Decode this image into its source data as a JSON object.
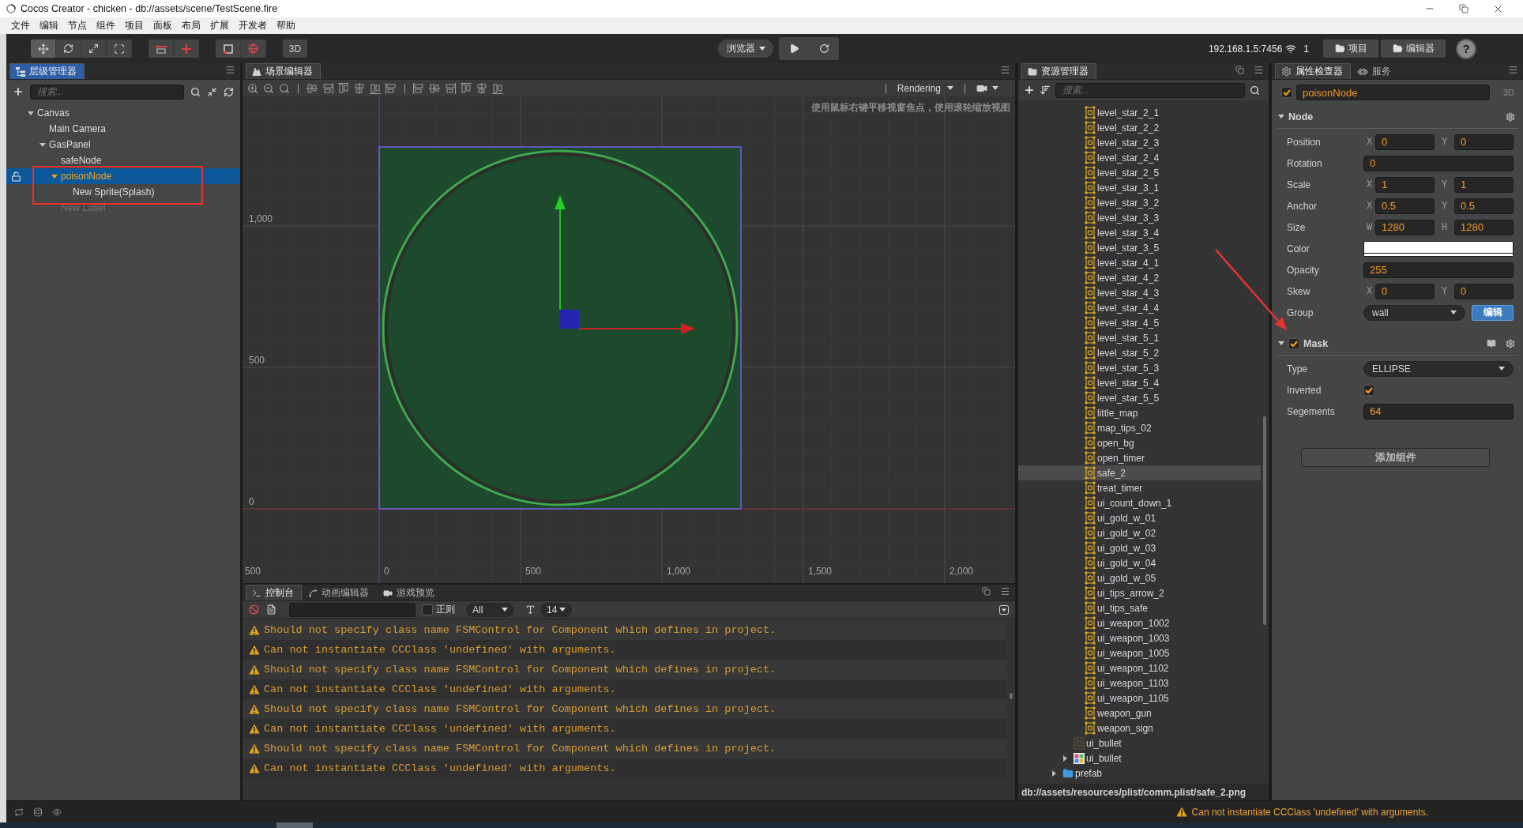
{
  "window": {
    "title": "Cocos Creator - chicken - db://assets/scene/TestScene.fire"
  },
  "menu": [
    "文件",
    "编辑",
    "节点",
    "组件",
    "项目",
    "面板",
    "布局",
    "扩展",
    "开发者",
    "帮助"
  ],
  "toolbar": {
    "transform_tools": [
      {
        "kind": "move",
        "selected": true
      },
      {
        "kind": "rotate",
        "selected": false
      },
      {
        "kind": "scale",
        "selected": false
      },
      {
        "kind": "rect",
        "selected": false
      }
    ],
    "view_3d": "3D",
    "preview_target": "浏览器",
    "server": "192.168.1.5:7456",
    "client_count": "1",
    "buttons": [
      "项目",
      "编辑器"
    ],
    "help": "?"
  },
  "hierarchy": {
    "tab": "层级管理器",
    "focused": true,
    "search_placeholder": "搜索...",
    "tree": [
      {
        "name": "Canvas",
        "expanded": true,
        "selected": false,
        "active": true,
        "children": [
          {
            "name": "Main Camera",
            "selected": false,
            "active": true
          },
          {
            "name": "GasPanel",
            "expanded": true,
            "selected": false,
            "active": true,
            "children": [
              {
                "name": "safeNode",
                "selected": false,
                "active": true
              },
              {
                "name": "poisonNode",
                "expanded": true,
                "selected": true,
                "active": true,
                "children": [
                  {
                    "name": "New Sprite(Splash)",
                    "selected": false,
                    "active": true
                  }
                ]
              },
              {
                "name": "New Label",
                "selected": false,
                "active": false
              }
            ]
          }
        ]
      }
    ]
  },
  "scene": {
    "tab": "场景编辑器",
    "focused": false,
    "render_mode": "Rendering",
    "hint": "使用鼠标右键平移视窗焦点，使用滚轮缩放视图",
    "y_labels": [
      "1,000",
      "500",
      "0"
    ],
    "x_labels": [
      "500",
      "0",
      "500",
      "1,000",
      "1,500",
      "2,000"
    ]
  },
  "console": {
    "tabs": [
      {
        "label": "控制台",
        "selected": true
      },
      {
        "label": "动画编辑器",
        "selected": false
      },
      {
        "label": "游戏预览",
        "selected": false
      }
    ],
    "regex": {
      "label": "正则",
      "checked": false
    },
    "level": "All",
    "font_size": "14",
    "logs": [
      {
        "kind": "warning",
        "text": "Should not specify class name FSMControl for Component which defines in project."
      },
      {
        "kind": "warning",
        "text": "Can not instantiate CCClass 'undefined' with arguments."
      },
      {
        "kind": "warning",
        "text": "Should not specify class name FSMControl for Component which defines in project."
      },
      {
        "kind": "warning",
        "text": "Can not instantiate CCClass 'undefined' with arguments."
      },
      {
        "kind": "warning",
        "text": "Should not specify class name FSMControl for Component which defines in project."
      },
      {
        "kind": "warning",
        "text": "Can not instantiate CCClass 'undefined' with arguments."
      },
      {
        "kind": "warning",
        "text": "Should not specify class name FSMControl for Component which defines in project."
      },
      {
        "kind": "warning",
        "text": "Can not instantiate CCClass 'undefined' with arguments."
      }
    ]
  },
  "assets": {
    "tab": "资源管理器",
    "focused": false,
    "search_placeholder": "搜索...",
    "tree": [
      {
        "children": [
          {
            "children": [
              {
                "name": "level_star_2_1",
                "kind": "sprite-frame",
                "selected": false
              },
              {
                "name": "level_star_2_2",
                "kind": "sprite-frame",
                "selected": false
              },
              {
                "name": "level_star_2_3",
                "kind": "sprite-frame",
                "selected": false
              },
              {
                "name": "level_star_2_4",
                "kind": "sprite-frame",
                "selected": false
              },
              {
                "name": "level_star_2_5",
                "kind": "sprite-frame",
                "selected": false
              },
              {
                "name": "level_star_3_1",
                "kind": "sprite-frame",
                "selected": false
              },
              {
                "name": "level_star_3_2",
                "kind": "sprite-frame",
                "selected": false
              },
              {
                "name": "level_star_3_3",
                "kind": "sprite-frame",
                "selected": false
              },
              {
                "name": "level_star_3_4",
                "kind": "sprite-frame",
                "selected": false
              },
              {
                "name": "level_star_3_5",
                "kind": "sprite-frame",
                "selected": false
              },
              {
                "name": "level_star_4_1",
                "kind": "sprite-frame",
                "selected": false
              },
              {
                "name": "level_star_4_2",
                "kind": "sprite-frame",
                "selected": false
              },
              {
                "name": "level_star_4_3",
                "kind": "sprite-frame",
                "selected": false
              },
              {
                "name": "level_star_4_4",
                "kind": "sprite-frame",
                "selected": false
              },
              {
                "name": "level_star_4_5",
                "kind": "sprite-frame",
                "selected": false
              },
              {
                "name": "level_star_5_1",
                "kind": "sprite-frame",
                "selected": false
              },
              {
                "name": "level_star_5_2",
                "kind": "sprite-frame",
                "selected": false
              },
              {
                "name": "level_star_5_3",
                "kind": "sprite-frame",
                "selected": false
              },
              {
                "name": "level_star_5_4",
                "kind": "sprite-frame",
                "selected": false
              },
              {
                "name": "level_star_5_5",
                "kind": "sprite-frame",
                "selected": false
              },
              {
                "name": "little_map",
                "kind": "sprite-frame",
                "selected": false
              },
              {
                "name": "map_tips_02",
                "kind": "sprite-frame",
                "selected": false
              },
              {
                "name": "open_bg",
                "kind": "sprite-frame",
                "selected": false
              },
              {
                "name": "open_timer",
                "kind": "sprite-frame",
                "selected": false
              },
              {
                "name": "safe_2",
                "kind": "sprite-frame",
                "selected": true
              },
              {
                "name": "treat_timer",
                "kind": "sprite-frame",
                "selected": false
              },
              {
                "name": "ui_count_down_1",
                "kind": "sprite-frame",
                "selected": false
              },
              {
                "name": "ui_gold_w_01",
                "kind": "sprite-frame",
                "selected": false
              },
              {
                "name": "ui_gold_w_02",
                "kind": "sprite-frame",
                "selected": false
              },
              {
                "name": "ui_gold_w_03",
                "kind": "sprite-frame",
                "selected": false
              },
              {
                "name": "ui_gold_w_04",
                "kind": "sprite-frame",
                "selected": false
              },
              {
                "name": "ui_gold_w_05",
                "kind": "sprite-frame",
                "selected": false
              },
              {
                "name": "ui_tips_arrow_2",
                "kind": "sprite-frame",
                "selected": false
              },
              {
                "name": "ui_tips_safe",
                "kind": "sprite-frame",
                "selected": false
              },
              {
                "name": "ui_weapon_1002",
                "kind": "sprite-frame",
                "selected": false
              },
              {
                "name": "ui_weapon_1003",
                "kind": "sprite-frame",
                "selected": false
              },
              {
                "name": "ui_weapon_1005",
                "kind": "sprite-frame",
                "selected": false
              },
              {
                "name": "ui_weapon_1102",
                "kind": "sprite-frame",
                "selected": false
              },
              {
                "name": "ui_weapon_1103",
                "kind": "sprite-frame",
                "selected": false
              },
              {
                "name": "ui_weapon_1105",
                "kind": "sprite-frame",
                "selected": false
              },
              {
                "name": "weapon_gun",
                "kind": "sprite-frame",
                "selected": false
              },
              {
                "name": "weapon_sign",
                "kind": "sprite-frame",
                "selected": false
              }
            ]
          },
          {
            "name": "ui_bullet",
            "kind": "plist",
            "selected": false
          },
          {
            "name": "ui_bullet",
            "kind": "texture",
            "selected": false,
            "expanded": false
          }
        ]
      },
      {
        "name": "prefab",
        "kind": "folder",
        "selected": false,
        "expanded": false
      }
    ],
    "path": "db://assets/resources/plist/comm.plist/safe_2.png"
  },
  "inspector": {
    "tabs": [
      {
        "label": "属性检查器",
        "selected": true
      },
      {
        "label": "服务",
        "selected": false
      }
    ],
    "focused": false,
    "node": {
      "active": true,
      "name": "poisonNode",
      "toggle_3d": "3D"
    },
    "components": [
      {
        "kind": "node",
        "title": "Node",
        "expanded": true,
        "props": [
          {
            "kind": "vec2",
            "label": "Position",
            "axes": [
              {
                "axis": "X",
                "value": "0"
              },
              {
                "axis": "Y",
                "value": "0"
              }
            ]
          },
          {
            "kind": "number",
            "label": "Rotation",
            "value": "0"
          },
          {
            "kind": "vec2",
            "label": "Scale",
            "axes": [
              {
                "axis": "X",
                "value": "1"
              },
              {
                "axis": "Y",
                "value": "1"
              }
            ]
          },
          {
            "kind": "vec2",
            "label": "Anchor",
            "axes": [
              {
                "axis": "X",
                "value": "0.5"
              },
              {
                "axis": "Y",
                "value": "0.5"
              }
            ]
          },
          {
            "kind": "vec2",
            "label": "Size",
            "axes": [
              {
                "axis": "W",
                "value": "1280"
              },
              {
                "axis": "H",
                "value": "1280"
              }
            ]
          },
          {
            "kind": "color",
            "label": "Color",
            "color": "#ffffff"
          },
          {
            "kind": "number",
            "label": "Opacity",
            "value": "255"
          },
          {
            "kind": "vec2",
            "label": "Skew",
            "axes": [
              {
                "axis": "X",
                "value": "0"
              },
              {
                "axis": "Y",
                "value": "0"
              }
            ]
          },
          {
            "kind": "select",
            "label": "Group",
            "value": "wall",
            "button": "编辑"
          }
        ]
      },
      {
        "kind": "component",
        "title": "Mask",
        "expanded": true,
        "enabled": true,
        "props": [
          {
            "kind": "select",
            "label": "Type",
            "value": "ELLIPSE"
          },
          {
            "kind": "checkbox",
            "label": "Inverted",
            "checked": true
          },
          {
            "kind": "number",
            "label": "Segements",
            "value": "64"
          }
        ]
      }
    ],
    "add_button": "添加组件"
  },
  "status_bar": {
    "kind": "warning",
    "message": "Can not instantiate CCClass 'undefined' with arguments."
  }
}
